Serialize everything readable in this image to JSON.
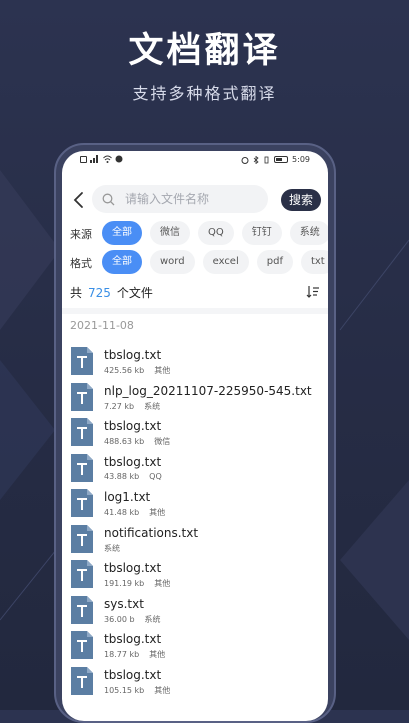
{
  "promo": {
    "title": "文档翻译",
    "subtitle": "支持多种格式翻译"
  },
  "status_bar": {
    "time": "5:09",
    "battery_pct": 50
  },
  "search": {
    "placeholder": "请输入文件名称",
    "button_label": "搜索"
  },
  "filters": {
    "source_label": "来源",
    "source_options": [
      "全部",
      "微信",
      "QQ",
      "钉钉",
      "系统"
    ],
    "source_selected": "全部",
    "format_label": "格式",
    "format_options": [
      "全部",
      "word",
      "excel",
      "pdf",
      "txt"
    ],
    "format_selected": "全部"
  },
  "summary": {
    "prefix": "共",
    "count": "725",
    "suffix": "个文件"
  },
  "date_group": "2021-11-08",
  "files": [
    {
      "name": "tbslog.txt",
      "size": "425.56 kb",
      "source": "其他"
    },
    {
      "name": "nlp_log_20211107-225950-545.txt",
      "size": "7.27 kb",
      "source": "系统"
    },
    {
      "name": "tbslog.txt",
      "size": "488.63 kb",
      "source": "微信"
    },
    {
      "name": "tbslog.txt",
      "size": "43.88 kb",
      "source": "QQ"
    },
    {
      "name": "log1.txt",
      "size": "41.48 kb",
      "source": "其他"
    },
    {
      "name": "notifications.txt",
      "size": "",
      "source": "系统"
    },
    {
      "name": "tbslog.txt",
      "size": "191.19 kb",
      "source": "其他"
    },
    {
      "name": "sys.txt",
      "size": "36.00 b",
      "source": "系统"
    },
    {
      "name": "tbslog.txt",
      "size": "18.77 kb",
      "source": "其他"
    },
    {
      "name": "tbslog.txt",
      "size": "105.15 kb",
      "source": "其他"
    }
  ],
  "colors": {
    "background": "#2a3049",
    "accent": "#4a8ef5",
    "file_icon": "#5b7ea3",
    "search_button": "#2a3047",
    "count": "#3a8fe6"
  },
  "icons": {
    "back": "chevron-left-icon",
    "search": "magnifier-icon",
    "sort": "sort-list-icon",
    "file": "text-file-icon"
  }
}
